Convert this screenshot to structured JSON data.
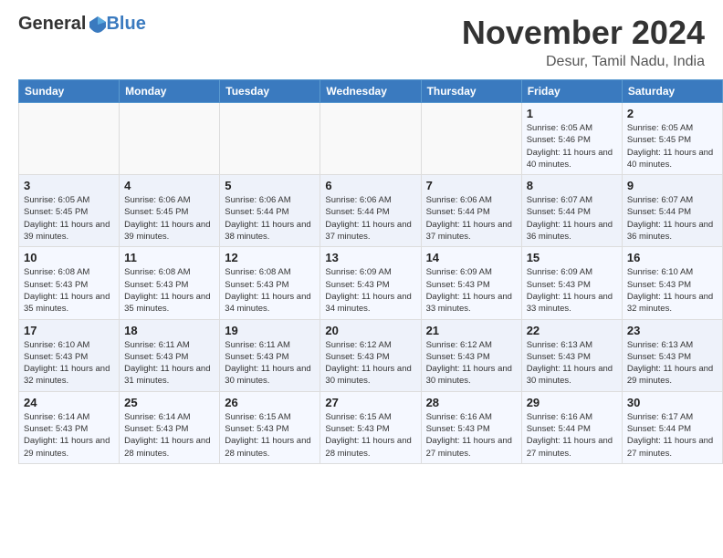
{
  "header": {
    "logo_line1": "General",
    "logo_line2": "Blue",
    "month": "November 2024",
    "location": "Desur, Tamil Nadu, India"
  },
  "weekdays": [
    "Sunday",
    "Monday",
    "Tuesday",
    "Wednesday",
    "Thursday",
    "Friday",
    "Saturday"
  ],
  "weeks": [
    [
      {
        "day": "",
        "info": ""
      },
      {
        "day": "",
        "info": ""
      },
      {
        "day": "",
        "info": ""
      },
      {
        "day": "",
        "info": ""
      },
      {
        "day": "",
        "info": ""
      },
      {
        "day": "1",
        "info": "Sunrise: 6:05 AM\nSunset: 5:46 PM\nDaylight: 11 hours and 40 minutes."
      },
      {
        "day": "2",
        "info": "Sunrise: 6:05 AM\nSunset: 5:45 PM\nDaylight: 11 hours and 40 minutes."
      }
    ],
    [
      {
        "day": "3",
        "info": "Sunrise: 6:05 AM\nSunset: 5:45 PM\nDaylight: 11 hours and 39 minutes."
      },
      {
        "day": "4",
        "info": "Sunrise: 6:06 AM\nSunset: 5:45 PM\nDaylight: 11 hours and 39 minutes."
      },
      {
        "day": "5",
        "info": "Sunrise: 6:06 AM\nSunset: 5:44 PM\nDaylight: 11 hours and 38 minutes."
      },
      {
        "day": "6",
        "info": "Sunrise: 6:06 AM\nSunset: 5:44 PM\nDaylight: 11 hours and 37 minutes."
      },
      {
        "day": "7",
        "info": "Sunrise: 6:06 AM\nSunset: 5:44 PM\nDaylight: 11 hours and 37 minutes."
      },
      {
        "day": "8",
        "info": "Sunrise: 6:07 AM\nSunset: 5:44 PM\nDaylight: 11 hours and 36 minutes."
      },
      {
        "day": "9",
        "info": "Sunrise: 6:07 AM\nSunset: 5:44 PM\nDaylight: 11 hours and 36 minutes."
      }
    ],
    [
      {
        "day": "10",
        "info": "Sunrise: 6:08 AM\nSunset: 5:43 PM\nDaylight: 11 hours and 35 minutes."
      },
      {
        "day": "11",
        "info": "Sunrise: 6:08 AM\nSunset: 5:43 PM\nDaylight: 11 hours and 35 minutes."
      },
      {
        "day": "12",
        "info": "Sunrise: 6:08 AM\nSunset: 5:43 PM\nDaylight: 11 hours and 34 minutes."
      },
      {
        "day": "13",
        "info": "Sunrise: 6:09 AM\nSunset: 5:43 PM\nDaylight: 11 hours and 34 minutes."
      },
      {
        "day": "14",
        "info": "Sunrise: 6:09 AM\nSunset: 5:43 PM\nDaylight: 11 hours and 33 minutes."
      },
      {
        "day": "15",
        "info": "Sunrise: 6:09 AM\nSunset: 5:43 PM\nDaylight: 11 hours and 33 minutes."
      },
      {
        "day": "16",
        "info": "Sunrise: 6:10 AM\nSunset: 5:43 PM\nDaylight: 11 hours and 32 minutes."
      }
    ],
    [
      {
        "day": "17",
        "info": "Sunrise: 6:10 AM\nSunset: 5:43 PM\nDaylight: 11 hours and 32 minutes."
      },
      {
        "day": "18",
        "info": "Sunrise: 6:11 AM\nSunset: 5:43 PM\nDaylight: 11 hours and 31 minutes."
      },
      {
        "day": "19",
        "info": "Sunrise: 6:11 AM\nSunset: 5:43 PM\nDaylight: 11 hours and 30 minutes."
      },
      {
        "day": "20",
        "info": "Sunrise: 6:12 AM\nSunset: 5:43 PM\nDaylight: 11 hours and 30 minutes."
      },
      {
        "day": "21",
        "info": "Sunrise: 6:12 AM\nSunset: 5:43 PM\nDaylight: 11 hours and 30 minutes."
      },
      {
        "day": "22",
        "info": "Sunrise: 6:13 AM\nSunset: 5:43 PM\nDaylight: 11 hours and 30 minutes."
      },
      {
        "day": "23",
        "info": "Sunrise: 6:13 AM\nSunset: 5:43 PM\nDaylight: 11 hours and 29 minutes."
      }
    ],
    [
      {
        "day": "24",
        "info": "Sunrise: 6:14 AM\nSunset: 5:43 PM\nDaylight: 11 hours and 29 minutes."
      },
      {
        "day": "25",
        "info": "Sunrise: 6:14 AM\nSunset: 5:43 PM\nDaylight: 11 hours and 28 minutes."
      },
      {
        "day": "26",
        "info": "Sunrise: 6:15 AM\nSunset: 5:43 PM\nDaylight: 11 hours and 28 minutes."
      },
      {
        "day": "27",
        "info": "Sunrise: 6:15 AM\nSunset: 5:43 PM\nDaylight: 11 hours and 28 minutes."
      },
      {
        "day": "28",
        "info": "Sunrise: 6:16 AM\nSunset: 5:43 PM\nDaylight: 11 hours and 27 minutes."
      },
      {
        "day": "29",
        "info": "Sunrise: 6:16 AM\nSunset: 5:44 PM\nDaylight: 11 hours and 27 minutes."
      },
      {
        "day": "30",
        "info": "Sunrise: 6:17 AM\nSunset: 5:44 PM\nDaylight: 11 hours and 27 minutes."
      }
    ]
  ]
}
